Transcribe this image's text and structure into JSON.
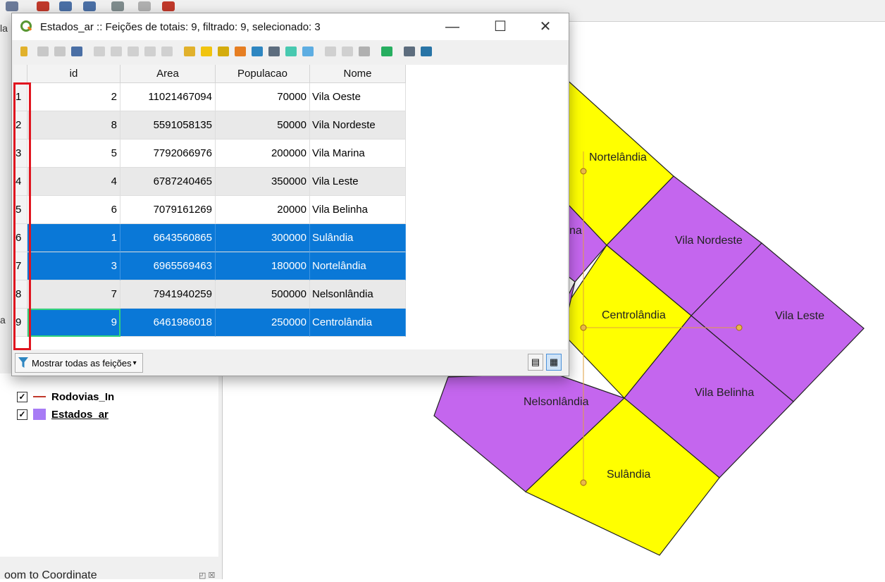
{
  "dialog": {
    "title": "Estados_ar :: Feições de totais: 9, filtrado: 9, selecionado: 3",
    "minimize": "—",
    "maximize": "☐",
    "close": "✕",
    "filter_button": "Mostrar todas as feições",
    "filter_arrow": "▾",
    "form_view_icon": "form-view-icon",
    "table_view_icon": "table-view-icon"
  },
  "table": {
    "columns": [
      "id",
      "Area",
      "Populacao",
      "Nome"
    ],
    "rows": [
      {
        "n": "1",
        "id": "2",
        "area": "11021467094",
        "pop": "70000",
        "nome": "Vila Oeste"
      },
      {
        "n": "2",
        "id": "8",
        "area": "5591058135",
        "pop": "50000",
        "nome": "Vila Nordeste"
      },
      {
        "n": "3",
        "id": "5",
        "area": "7792066976",
        "pop": "200000",
        "nome": "Vila Marina"
      },
      {
        "n": "4",
        "id": "4",
        "area": "6787240465",
        "pop": "350000",
        "nome": "Vila Leste"
      },
      {
        "n": "5",
        "id": "6",
        "area": "7079161269",
        "pop": "20000",
        "nome": "Vila Belinha"
      },
      {
        "n": "6",
        "id": "1",
        "area": "6643560865",
        "pop": "300000",
        "nome": "Sulândia"
      },
      {
        "n": "7",
        "id": "3",
        "area": "6965569463",
        "pop": "180000",
        "nome": "Nortelândia"
      },
      {
        "n": "8",
        "id": "7",
        "area": "7941940259",
        "pop": "500000",
        "nome": "Nelsonlândia"
      },
      {
        "n": "9",
        "id": "9",
        "area": "6461986018",
        "pop": "250000",
        "nome": "Centrolândia"
      }
    ],
    "selected_rows": [
      "6",
      "7",
      "9"
    ]
  },
  "layers": {
    "items": [
      {
        "name": "Rodovias_In",
        "checked": "✓"
      },
      {
        "name": "Estados_ar",
        "checked": "✓"
      }
    ]
  },
  "dock": {
    "zoom_title": "oom to Coordinate",
    "zoom_buttons": "◰ ☒",
    "frag_la": "la",
    "frag_a": "a"
  },
  "map": {
    "labels": {
      "nortelandia": "Nortelândia",
      "vila_nordeste": "Vila Nordeste",
      "centrolandia": "Centrolândia",
      "vila_leste": "Vila Leste",
      "vila_belinha": "Vila Belinha",
      "nelsonlandia": "Nelsonlândia",
      "sulandia": "Sulândia",
      "partial_na": "na"
    },
    "colors": {
      "yellow": "#ffff00",
      "purple": "#c466ee",
      "line": "#c0392b"
    }
  }
}
